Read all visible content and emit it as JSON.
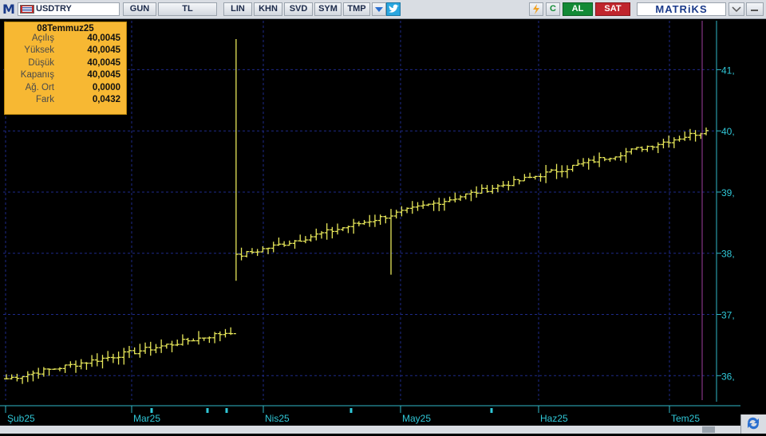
{
  "toolbar": {
    "logo": "M",
    "symbol": "USDTRY",
    "buttons": [
      "GUN",
      "TL",
      "LIN",
      "KHN",
      "SVD",
      "SYM",
      "TMP"
    ],
    "al": "AL",
    "sat": "SAT",
    "brand": "MATRiKS",
    "refresh_icon": "C",
    "bolt_icon": "lightning-icon",
    "bird_icon": "twitter-bird-icon"
  },
  "tooltip": {
    "date": "08Temmuz25",
    "rows": [
      {
        "label": "Açılış",
        "value": "40,0045"
      },
      {
        "label": "Yüksek",
        "value": "40,0045"
      },
      {
        "label": "Düşük",
        "value": "40,0045"
      },
      {
        "label": "Kapanış",
        "value": "40,0045"
      },
      {
        "label": "Ağ. Ort",
        "value": "0,0000"
      },
      {
        "label": "Fark",
        "value": "0,0432"
      }
    ]
  },
  "colors": {
    "background": "#000000",
    "bars": "#e8e85a",
    "grid": "#1e2a8a",
    "axis": "#30b8c8",
    "cursor": "#a040a0",
    "tooltip_bg": "#f7b833"
  },
  "chart_data": {
    "type": "ohlc",
    "symbol": "USDTRY",
    "ylim": [
      35.6,
      41.8
    ],
    "y_ticks": [
      "36,",
      "37,",
      "38,",
      "39,",
      "40,",
      "41,"
    ],
    "x_ticks": [
      "Şub25",
      "Mar25",
      "Nis25",
      "May25",
      "Haz25",
      "Tem25"
    ],
    "close_start": 35.95,
    "close_end": 40.0045,
    "spike_high": 41.5,
    "spike_low": 37.65
  }
}
